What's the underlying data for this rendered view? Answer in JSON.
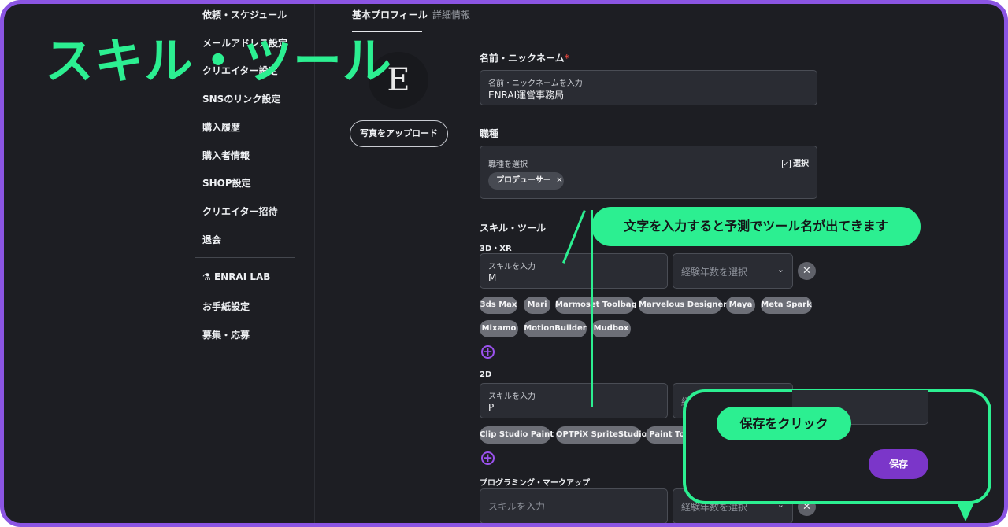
{
  "sidebar": {
    "items": [
      {
        "label": "依頼・スケジュール"
      },
      {
        "label": "メールアドレス設定"
      },
      {
        "label": "クリエイター設定"
      },
      {
        "label": "SNSのリンク設定"
      },
      {
        "label": "購入履歴"
      },
      {
        "label": "購入者情報"
      },
      {
        "label": "SHOP設定"
      },
      {
        "label": "クリエイター招待"
      },
      {
        "label": "退会"
      }
    ],
    "lab": {
      "icon": "flask-icon",
      "label": "ENRAI LAB"
    },
    "items2": [
      {
        "label": "お手紙設定"
      },
      {
        "label": "募集・応募"
      }
    ]
  },
  "tabs": [
    {
      "label": "基本プロフィール",
      "active": true
    },
    {
      "label": "詳細情報",
      "active": false
    }
  ],
  "avatar": {
    "letter": "E"
  },
  "upload_label": "写真をアップロード",
  "name_section": {
    "label": "名前・ニックネーム",
    "required": "*",
    "field_label": "名前・ニックネームを入力",
    "value": "ENRAI運営事務局"
  },
  "job_section": {
    "label": "職種",
    "field_label": "職種を選択",
    "select_label": "選択",
    "chip": "プロデューサー"
  },
  "skills": {
    "title": "スキル・ツール",
    "input_label": "スキルを入力",
    "years_placeholder": "経験年数を選択",
    "groups": [
      {
        "name": "3D・XR",
        "value": "M",
        "suggestions": [
          "3ds Max",
          "Mari",
          "Marmoset Toolbag",
          "Marvelous Designer",
          "Maya",
          "Meta Spark",
          "Mixamo",
          "MotionBuilder",
          "Mudbox"
        ]
      },
      {
        "name": "2D",
        "value": "P",
        "suggestions": [
          "Clip Studio Paint",
          "OPTPiX SpriteStudio",
          "Paint Tool"
        ]
      },
      {
        "name": "プログラミング・マークアップ",
        "value": "",
        "suggestions": []
      }
    ]
  },
  "annotations": {
    "big_title": "スキル・ツール",
    "callout_prediction": "文字を入力すると予測でツール名が出てきます",
    "callout_save": "保存をクリック"
  },
  "save_label": "保存",
  "colors": {
    "accent_green": "#2cef91",
    "frame_purple": "#8b55e3",
    "save_purple": "#7b36c9",
    "background": "#1d1e23"
  }
}
